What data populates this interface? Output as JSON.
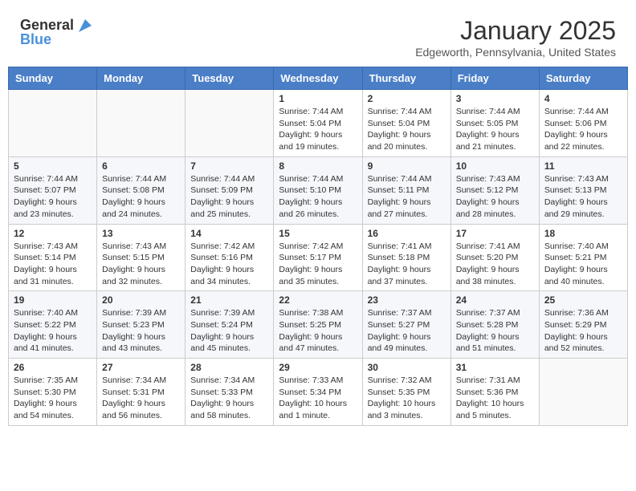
{
  "header": {
    "logo_line1": "General",
    "logo_line2": "Blue",
    "month": "January 2025",
    "location": "Edgeworth, Pennsylvania, United States"
  },
  "days_of_week": [
    "Sunday",
    "Monday",
    "Tuesday",
    "Wednesday",
    "Thursday",
    "Friday",
    "Saturday"
  ],
  "weeks": [
    [
      {
        "day": "",
        "info": ""
      },
      {
        "day": "",
        "info": ""
      },
      {
        "day": "",
        "info": ""
      },
      {
        "day": "1",
        "info": "Sunrise: 7:44 AM\nSunset: 5:04 PM\nDaylight: 9 hours and 19 minutes."
      },
      {
        "day": "2",
        "info": "Sunrise: 7:44 AM\nSunset: 5:04 PM\nDaylight: 9 hours and 20 minutes."
      },
      {
        "day": "3",
        "info": "Sunrise: 7:44 AM\nSunset: 5:05 PM\nDaylight: 9 hours and 21 minutes."
      },
      {
        "day": "4",
        "info": "Sunrise: 7:44 AM\nSunset: 5:06 PM\nDaylight: 9 hours and 22 minutes."
      }
    ],
    [
      {
        "day": "5",
        "info": "Sunrise: 7:44 AM\nSunset: 5:07 PM\nDaylight: 9 hours and 23 minutes."
      },
      {
        "day": "6",
        "info": "Sunrise: 7:44 AM\nSunset: 5:08 PM\nDaylight: 9 hours and 24 minutes."
      },
      {
        "day": "7",
        "info": "Sunrise: 7:44 AM\nSunset: 5:09 PM\nDaylight: 9 hours and 25 minutes."
      },
      {
        "day": "8",
        "info": "Sunrise: 7:44 AM\nSunset: 5:10 PM\nDaylight: 9 hours and 26 minutes."
      },
      {
        "day": "9",
        "info": "Sunrise: 7:44 AM\nSunset: 5:11 PM\nDaylight: 9 hours and 27 minutes."
      },
      {
        "day": "10",
        "info": "Sunrise: 7:43 AM\nSunset: 5:12 PM\nDaylight: 9 hours and 28 minutes."
      },
      {
        "day": "11",
        "info": "Sunrise: 7:43 AM\nSunset: 5:13 PM\nDaylight: 9 hours and 29 minutes."
      }
    ],
    [
      {
        "day": "12",
        "info": "Sunrise: 7:43 AM\nSunset: 5:14 PM\nDaylight: 9 hours and 31 minutes."
      },
      {
        "day": "13",
        "info": "Sunrise: 7:43 AM\nSunset: 5:15 PM\nDaylight: 9 hours and 32 minutes."
      },
      {
        "day": "14",
        "info": "Sunrise: 7:42 AM\nSunset: 5:16 PM\nDaylight: 9 hours and 34 minutes."
      },
      {
        "day": "15",
        "info": "Sunrise: 7:42 AM\nSunset: 5:17 PM\nDaylight: 9 hours and 35 minutes."
      },
      {
        "day": "16",
        "info": "Sunrise: 7:41 AM\nSunset: 5:18 PM\nDaylight: 9 hours and 37 minutes."
      },
      {
        "day": "17",
        "info": "Sunrise: 7:41 AM\nSunset: 5:20 PM\nDaylight: 9 hours and 38 minutes."
      },
      {
        "day": "18",
        "info": "Sunrise: 7:40 AM\nSunset: 5:21 PM\nDaylight: 9 hours and 40 minutes."
      }
    ],
    [
      {
        "day": "19",
        "info": "Sunrise: 7:40 AM\nSunset: 5:22 PM\nDaylight: 9 hours and 41 minutes."
      },
      {
        "day": "20",
        "info": "Sunrise: 7:39 AM\nSunset: 5:23 PM\nDaylight: 9 hours and 43 minutes."
      },
      {
        "day": "21",
        "info": "Sunrise: 7:39 AM\nSunset: 5:24 PM\nDaylight: 9 hours and 45 minutes."
      },
      {
        "day": "22",
        "info": "Sunrise: 7:38 AM\nSunset: 5:25 PM\nDaylight: 9 hours and 47 minutes."
      },
      {
        "day": "23",
        "info": "Sunrise: 7:37 AM\nSunset: 5:27 PM\nDaylight: 9 hours and 49 minutes."
      },
      {
        "day": "24",
        "info": "Sunrise: 7:37 AM\nSunset: 5:28 PM\nDaylight: 9 hours and 51 minutes."
      },
      {
        "day": "25",
        "info": "Sunrise: 7:36 AM\nSunset: 5:29 PM\nDaylight: 9 hours and 52 minutes."
      }
    ],
    [
      {
        "day": "26",
        "info": "Sunrise: 7:35 AM\nSunset: 5:30 PM\nDaylight: 9 hours and 54 minutes."
      },
      {
        "day": "27",
        "info": "Sunrise: 7:34 AM\nSunset: 5:31 PM\nDaylight: 9 hours and 56 minutes."
      },
      {
        "day": "28",
        "info": "Sunrise: 7:34 AM\nSunset: 5:33 PM\nDaylight: 9 hours and 58 minutes."
      },
      {
        "day": "29",
        "info": "Sunrise: 7:33 AM\nSunset: 5:34 PM\nDaylight: 10 hours and 1 minute."
      },
      {
        "day": "30",
        "info": "Sunrise: 7:32 AM\nSunset: 5:35 PM\nDaylight: 10 hours and 3 minutes."
      },
      {
        "day": "31",
        "info": "Sunrise: 7:31 AM\nSunset: 5:36 PM\nDaylight: 10 hours and 5 minutes."
      },
      {
        "day": "",
        "info": ""
      }
    ]
  ]
}
